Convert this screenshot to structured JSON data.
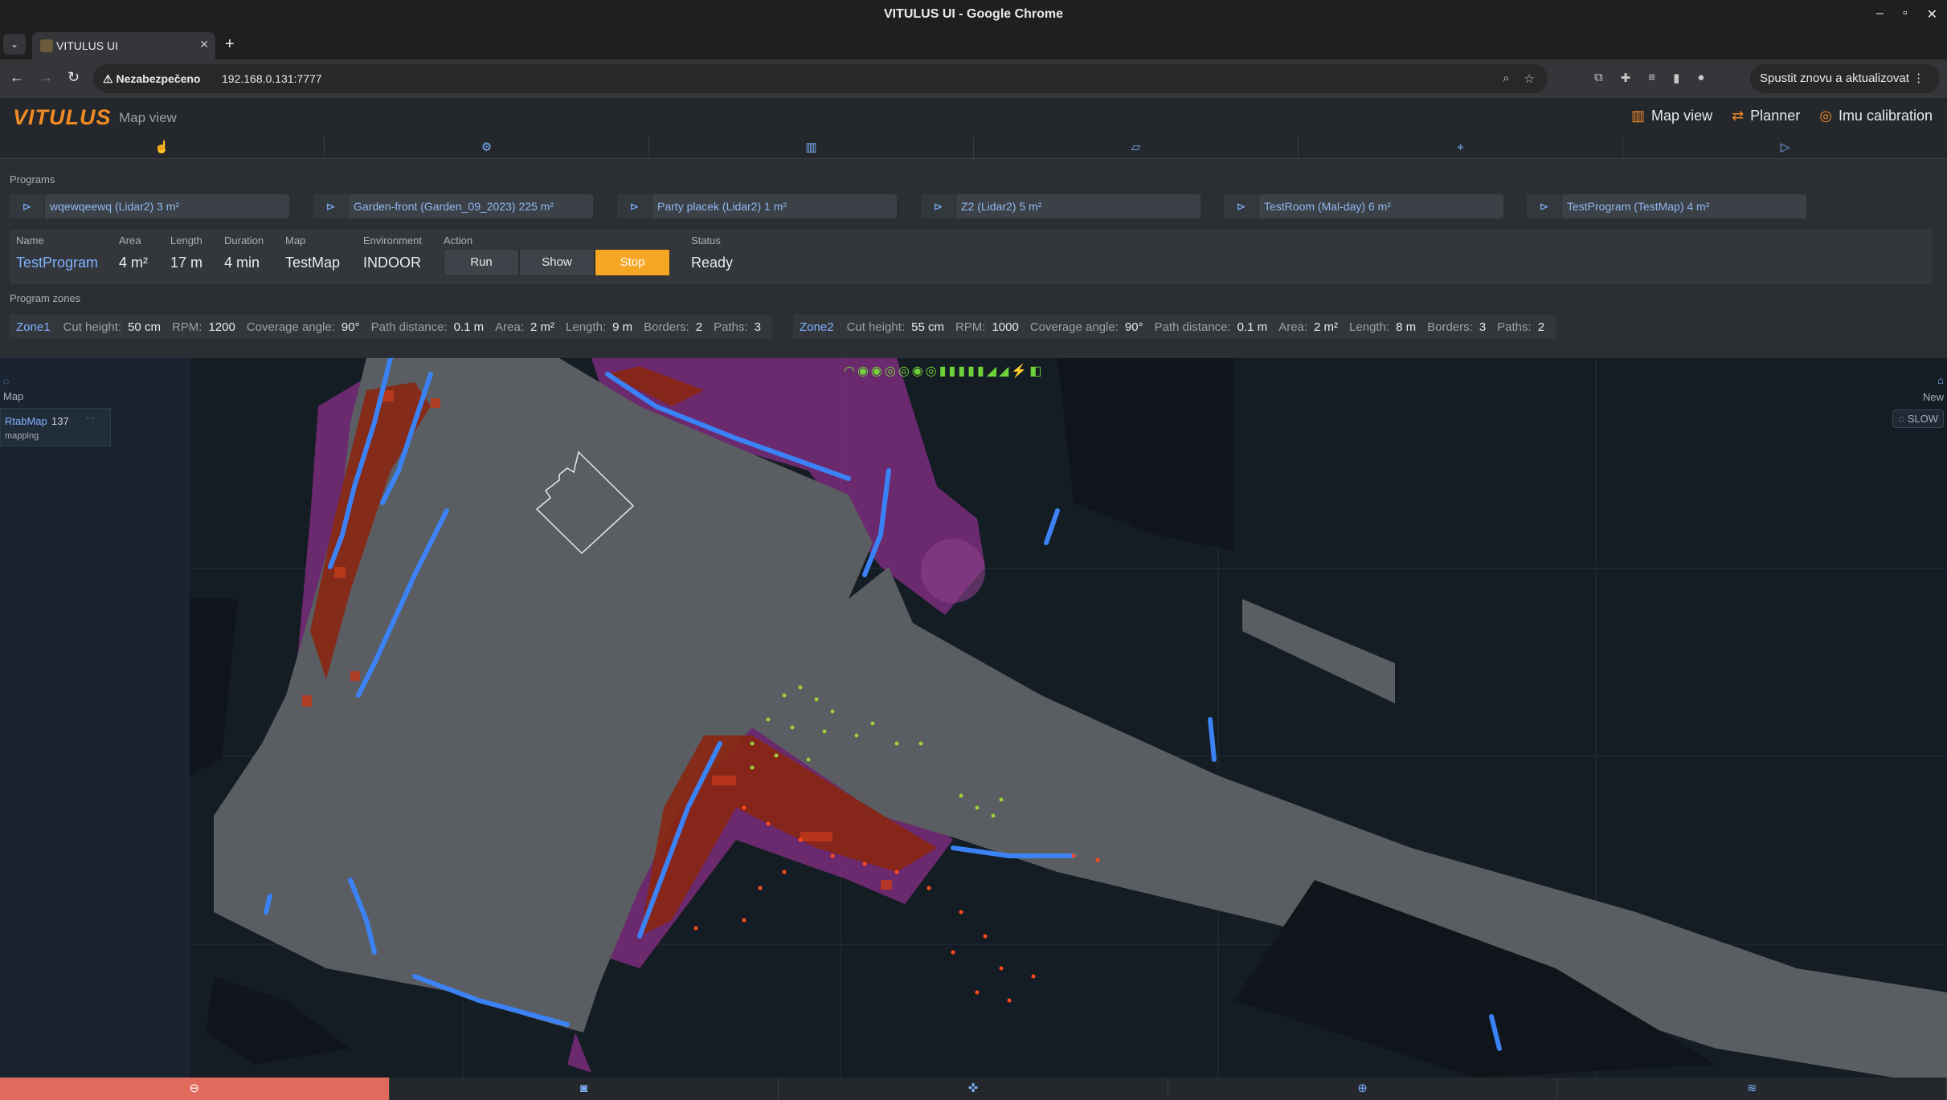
{
  "window": {
    "title": "VITULUS UI - Google Chrome"
  },
  "browser": {
    "tab_title": "VITULUS UI",
    "security_label": "Nezabezpečeno",
    "url": "192.168.0.131:7777",
    "relaunch_label": "Spustit znovu a aktualizovat"
  },
  "app": {
    "logo": "VITULUS",
    "page_title": "Map view",
    "nav": [
      {
        "label": "Map view",
        "icon": "map-icon"
      },
      {
        "label": "Planner",
        "icon": "shuffle-icon"
      },
      {
        "label": "Imu calibration",
        "icon": "gauge-icon"
      }
    ]
  },
  "tooltabs": [
    "hand-icon",
    "gear-icon",
    "map-icon",
    "field-icon",
    "location-pin-icon",
    "play-icon"
  ],
  "programs": {
    "label": "Programs",
    "items": [
      {
        "label": "wqewqeewq (Lidar2) 3 m²"
      },
      {
        "label": "Garden-front (Garden_09_2023) 225 m²"
      },
      {
        "label": "Party placek (Lidar2) 1 m²"
      },
      {
        "label": "Z2 (Lidar2) 5 m²"
      },
      {
        "label": "TestRoom (Mal-day) 6 m²"
      },
      {
        "label": "TestProgram (TestMap) 4 m²"
      }
    ]
  },
  "detail": {
    "name_h": "Name",
    "name": "TestProgram",
    "area_h": "Area",
    "area": "4 m²",
    "length_h": "Length",
    "length": "17 m",
    "duration_h": "Duration",
    "duration": "4 min",
    "map_h": "Map",
    "map": "TestMap",
    "env_h": "Environment",
    "env": "INDOOR",
    "action_h": "Action",
    "run": "Run",
    "show": "Show",
    "stop": "Stop",
    "status_h": "Status",
    "status": "Ready"
  },
  "zones": {
    "label": "Program zones",
    "items": [
      {
        "name": "Zone1",
        "cut_h": "Cut height:",
        "cut": "50 cm",
        "rpm_h": "RPM:",
        "rpm": "1200",
        "angle_h": "Coverage angle:",
        "angle": "90°",
        "pd_h": "Path distance:",
        "pd": "0.1 m",
        "area_h": "Area:",
        "area": "2 m²",
        "len_h": "Length:",
        "len": "9 m",
        "b_h": "Borders:",
        "b": "2",
        "p_h": "Paths:",
        "p": "3"
      },
      {
        "name": "Zone2",
        "cut_h": "Cut height:",
        "cut": "55 cm",
        "rpm_h": "RPM:",
        "rpm": "1000",
        "angle_h": "Coverage angle:",
        "angle": "90°",
        "pd_h": "Path distance:",
        "pd": "0.1 m",
        "area_h": "Area:",
        "area": "2 m²",
        "len_h": "Length:",
        "len": "8 m",
        "b_h": "Borders:",
        "b": "3",
        "p_h": "Paths:",
        "p": "2"
      }
    ]
  },
  "map": {
    "side_label": "Map",
    "layer_name": "RtabMap",
    "layer_count": "137",
    "layer_state": "mapping",
    "new_label": "New",
    "slow_label": "SLOW"
  },
  "bottom_tabs": [
    "record-icon",
    "camera-icon",
    "gamepad-icon",
    "target-icon",
    "layers-icon"
  ],
  "colors": {
    "accent": "#f08a24",
    "link": "#7fb2ff",
    "stop": "#f5a623",
    "active_bottom": "#e06a5c"
  }
}
